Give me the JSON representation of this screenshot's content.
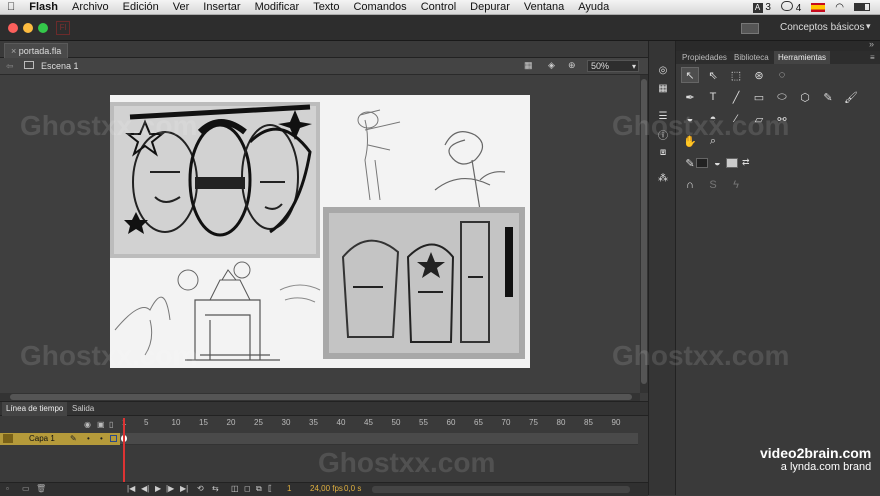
{
  "menubar": {
    "apple": "",
    "app_name": "Flash",
    "items": [
      "Archivo",
      "Edición",
      "Ver",
      "Insertar",
      "Modificar",
      "Texto",
      "Comandos",
      "Control",
      "Depurar",
      "Ventana",
      "Ayuda"
    ],
    "status_count_a": "3",
    "status_count_b": "4"
  },
  "titlebar": {
    "workspace": "Conceptos básicos"
  },
  "document": {
    "tab_name": "portada.fla",
    "scene": "Escena 1",
    "zoom": "50%"
  },
  "panel": {
    "tabs": [
      "Propiedades",
      "Biblioteca",
      "Herramientas"
    ],
    "active_tab": "Herramientas"
  },
  "timeline": {
    "tabs": [
      "Línea de tiempo",
      "Salida"
    ],
    "ruler": [
      "1",
      "5",
      "10",
      "15",
      "20",
      "25",
      "30",
      "35",
      "40",
      "45",
      "50",
      "55",
      "60",
      "65",
      "70",
      "75",
      "80",
      "85",
      "90"
    ],
    "layer_name": "Capa 1",
    "current_frame": "1",
    "fps": "24,00 fps",
    "time": "0,0 s"
  },
  "watermark": "Ghostxx.com",
  "brand": {
    "line1": "video2brain.com",
    "line2": "a lynda.com brand"
  }
}
